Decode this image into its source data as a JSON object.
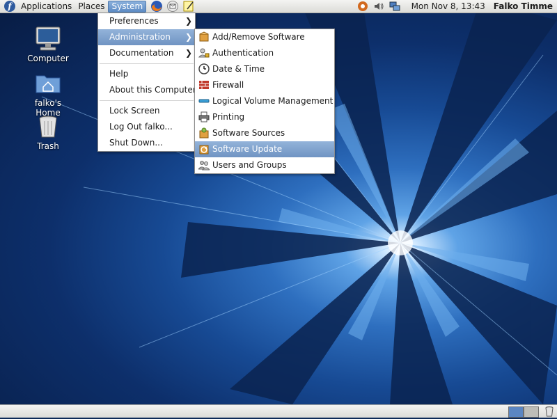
{
  "top_panel": {
    "menus": {
      "applications": "Applications",
      "places": "Places",
      "system": "System"
    },
    "launchers": [
      "firefox-icon",
      "evolution-mail-icon",
      "notes-icon"
    ],
    "tray": [
      "network-monitor-icon",
      "volume-icon",
      "network-icon"
    ],
    "clock": "Mon Nov  8, 13:43",
    "user": "Falko Timme"
  },
  "desktop": {
    "icons": [
      {
        "label": "Computer",
        "icon": "computer-icon"
      },
      {
        "label": "falko's Home",
        "icon": "home-folder-icon"
      },
      {
        "label": "Trash",
        "icon": "trash-icon"
      }
    ]
  },
  "system_menu": {
    "items": {
      "preferences": "Preferences",
      "administration": "Administration",
      "documentation": "Documentation",
      "help": "Help",
      "about": "About this Computer",
      "lock": "Lock Screen",
      "logout": "Log Out falko...",
      "shutdown": "Shut Down..."
    },
    "highlighted": "Administration"
  },
  "administration_menu": {
    "items": [
      {
        "label": "Add/Remove Software",
        "icon": "package-icon"
      },
      {
        "label": "Authentication",
        "icon": "authentication-icon"
      },
      {
        "label": "Date & Time",
        "icon": "clock-icon"
      },
      {
        "label": "Firewall",
        "icon": "firewall-icon"
      },
      {
        "label": "Logical Volume Management",
        "icon": "lvm-icon"
      },
      {
        "label": "Printing",
        "icon": "printer-icon"
      },
      {
        "label": "Software Sources",
        "icon": "software-sources-icon"
      },
      {
        "label": "Software Update",
        "icon": "software-update-icon"
      },
      {
        "label": "Users and Groups",
        "icon": "users-icon"
      }
    ],
    "highlighted": "Software Update"
  },
  "bottom_panel": {
    "workspaces": [
      "workspace-1",
      "workspace-2"
    ],
    "active_workspace": "workspace-1"
  },
  "colors": {
    "highlight": "#7a9bc8",
    "panel": "#e6e6e3",
    "wallpaper_dark": "#0d2f6b",
    "wallpaper_light": "#5fa3e6"
  }
}
